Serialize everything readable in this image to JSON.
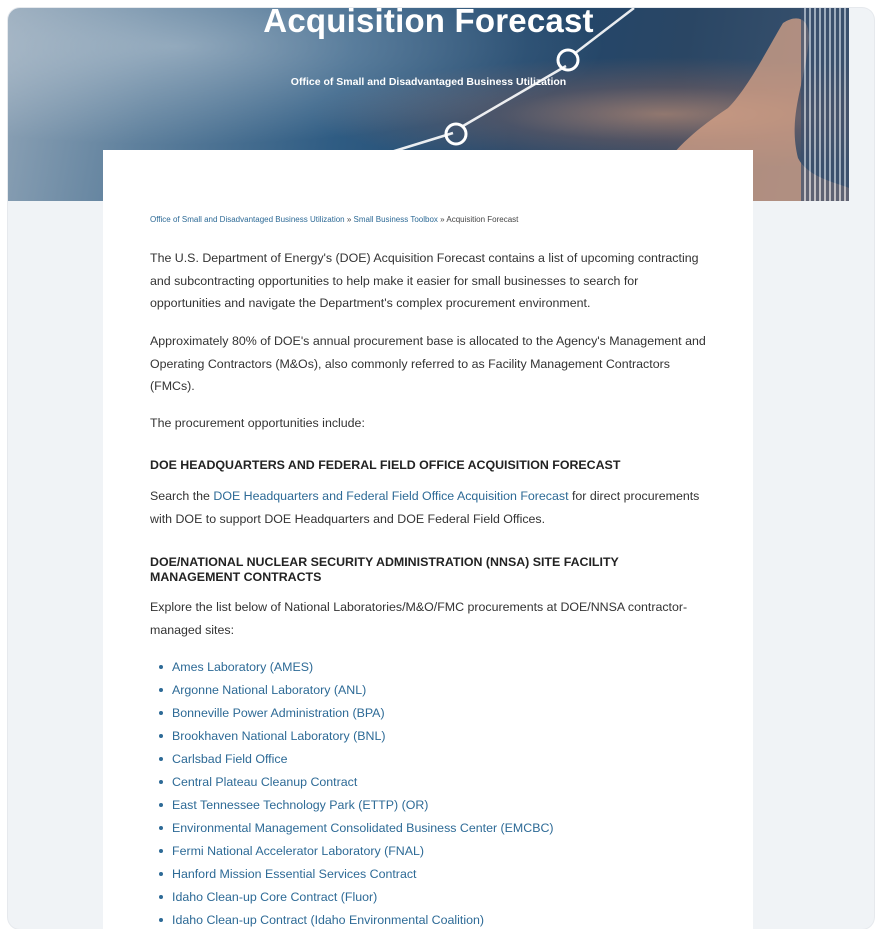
{
  "hero": {
    "title": "Acquisition Forecast",
    "subtitle": "Office of Small and Disadvantaged Business Utilization"
  },
  "breadcrumb": {
    "items": [
      "Office of Small and Disadvantaged Business Utilization",
      "Small Business Toolbox"
    ],
    "separator": "»",
    "current": "Acquisition Forecast"
  },
  "intro": {
    "p1": "The U.S. Department of Energy's (DOE) Acquisition Forecast contains a list of upcoming contracting and subcontracting opportunities to help make it easier for small businesses to search for opportunities and navigate the Department's complex procurement environment.",
    "p2": "Approximately 80% of DOE's annual procurement base is allocated to the Agency's Management and Operating Contractors (M&Os), also commonly referred to as Facility Management Contractors (FMCs).",
    "p3": "The procurement opportunities include:"
  },
  "section1": {
    "heading": "DOE HEADQUARTERS AND FEDERAL FIELD OFFICE ACQUISITION FORECAST",
    "text_before": "Search the ",
    "link": "DOE Headquarters and Federal Field Office Acquisition Forecast",
    "text_after": " for direct procurements with DOE to support DOE Headquarters and DOE Federal Field Offices."
  },
  "section2": {
    "heading": "DOE/NATIONAL NUCLEAR SECURITY ADMINISTRATION (NNSA) SITE FACILITY MANAGEMENT CONTRACTS",
    "text": "Explore the list below of National Laboratories/M&O/FMC procurements at DOE/NNSA contractor-managed sites:",
    "sites": [
      "Ames Laboratory (AMES)",
      "Argonne National Laboratory (ANL)",
      "Bonneville Power Administration (BPA)",
      "Brookhaven National Laboratory (BNL)",
      "Carlsbad Field Office",
      "Central Plateau Cleanup Contract",
      "East Tennessee Technology Park (ETTP) (OR)",
      "Environmental Management Consolidated Business Center (EMCBC)",
      "Fermi National Accelerator Laboratory (FNAL)",
      "Hanford Mission Essential Services Contract",
      "Idaho Clean-up Core Contract (Fluor)",
      "Idaho Clean-up Contract (Idaho Environmental Coalition)"
    ]
  },
  "colors": {
    "link": "#2d6a96",
    "text": "#333333",
    "page_bg": "#f0f3f6"
  }
}
